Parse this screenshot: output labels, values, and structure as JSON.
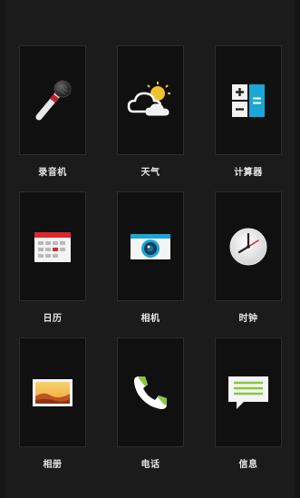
{
  "apps": [
    {
      "label": "录音机",
      "icon": "microphone-icon",
      "name": "recorder"
    },
    {
      "label": "天气",
      "icon": "weather-icon",
      "name": "weather"
    },
    {
      "label": "计算器",
      "icon": "calculator-icon",
      "name": "calculator"
    },
    {
      "label": "日历",
      "icon": "calendar-icon",
      "name": "calendar"
    },
    {
      "label": "相机",
      "icon": "camera-icon",
      "name": "camera"
    },
    {
      "label": "时钟",
      "icon": "clock-icon",
      "name": "clock"
    },
    {
      "label": "相册",
      "icon": "gallery-icon",
      "name": "gallery"
    },
    {
      "label": "电话",
      "icon": "phone-icon",
      "name": "phone"
    },
    {
      "label": "信息",
      "icon": "message-icon",
      "name": "messages"
    }
  ],
  "colors": {
    "background": "#151515",
    "tile": "#101010",
    "tile_border": "#2c2c2c",
    "label": "#e6e6e6",
    "accent_blue": "#1aa6d6",
    "accent_green": "#8cc63f"
  }
}
